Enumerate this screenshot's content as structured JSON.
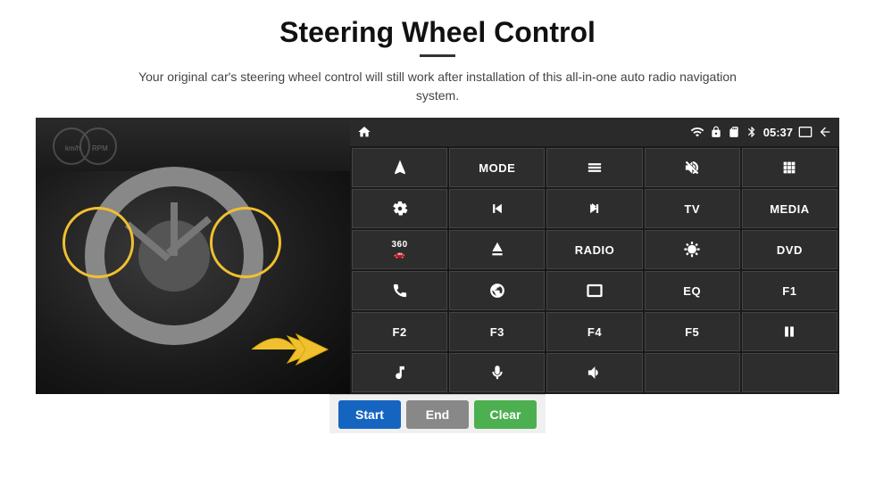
{
  "page": {
    "title": "Steering Wheel Control",
    "subtitle": "Your original car's steering wheel control will still work after installation of this all-in-one auto radio navigation system."
  },
  "status_bar": {
    "time": "05:37"
  },
  "grid_buttons": [
    {
      "id": "home",
      "type": "icon",
      "label": "⌂"
    },
    {
      "id": "mode",
      "type": "text",
      "label": "MODE"
    },
    {
      "id": "list",
      "type": "icon",
      "label": "≡"
    },
    {
      "id": "mute",
      "type": "icon",
      "label": "🔇"
    },
    {
      "id": "grid",
      "type": "icon",
      "label": "⊞"
    },
    {
      "id": "navigate",
      "type": "icon",
      "label": "➤"
    },
    {
      "id": "prev",
      "type": "icon",
      "label": "⏮"
    },
    {
      "id": "next",
      "type": "icon",
      "label": "⏭"
    },
    {
      "id": "tv",
      "type": "text",
      "label": "TV"
    },
    {
      "id": "media",
      "type": "text",
      "label": "MEDIA"
    },
    {
      "id": "cam360",
      "type": "icon",
      "label": "360"
    },
    {
      "id": "eject",
      "type": "icon",
      "label": "⏏"
    },
    {
      "id": "radio",
      "type": "text",
      "label": "RADIO"
    },
    {
      "id": "brightness",
      "type": "icon",
      "label": "☀"
    },
    {
      "id": "dvd",
      "type": "text",
      "label": "DVD"
    },
    {
      "id": "phone",
      "type": "icon",
      "label": "✆"
    },
    {
      "id": "globe",
      "type": "icon",
      "label": "◎"
    },
    {
      "id": "screen",
      "type": "icon",
      "label": "▬"
    },
    {
      "id": "eq",
      "type": "text",
      "label": "EQ"
    },
    {
      "id": "f1",
      "type": "text",
      "label": "F1"
    },
    {
      "id": "f2",
      "type": "text",
      "label": "F2"
    },
    {
      "id": "f3",
      "type": "text",
      "label": "F3"
    },
    {
      "id": "f4",
      "type": "text",
      "label": "F4"
    },
    {
      "id": "f5",
      "type": "text",
      "label": "F5"
    },
    {
      "id": "playpause",
      "type": "icon",
      "label": "▶⏸"
    },
    {
      "id": "music",
      "type": "icon",
      "label": "♪"
    },
    {
      "id": "mic",
      "type": "icon",
      "label": "🎤"
    },
    {
      "id": "volphone",
      "type": "icon",
      "label": "🔊/✆"
    },
    {
      "id": "empty1",
      "type": "text",
      "label": ""
    },
    {
      "id": "empty2",
      "type": "text",
      "label": ""
    }
  ],
  "action_buttons": {
    "start": "Start",
    "end": "End",
    "clear": "Clear"
  }
}
